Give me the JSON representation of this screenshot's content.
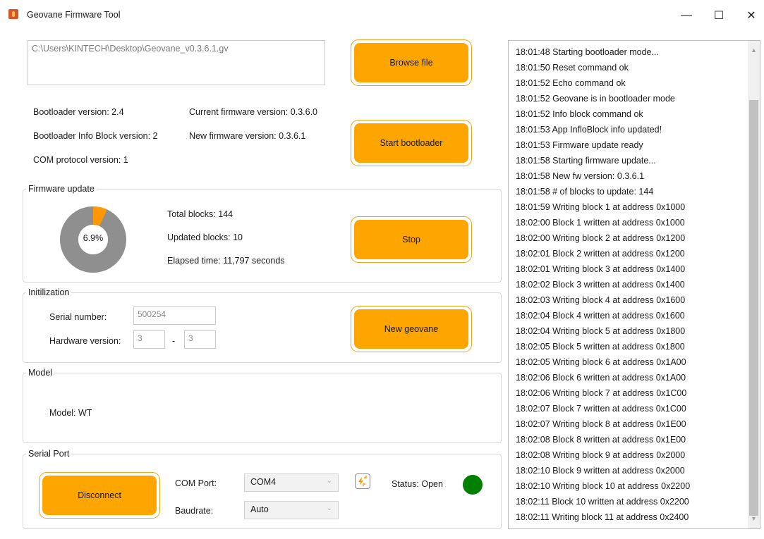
{
  "window": {
    "title": "Geovane Firmware Tool",
    "minimize": "—",
    "maximize": "☐",
    "close": "✕"
  },
  "file": {
    "path": "C:\\Users\\KINTECH\\Desktop\\Geovane_v0.3.6.1.gv",
    "browse_label": "Browse file"
  },
  "versions": {
    "bootloader": "Bootloader version: 2.4",
    "bootloader_info_block": "Bootloader Info Block version: 2",
    "com_protocol": "COM protocol version: 1",
    "current_firmware": "Current firmware version: 0.3.6.0",
    "new_firmware": "New firmware version: 0.3.6.1"
  },
  "start_bootloader_label": "Start bootloader",
  "firmware_update": {
    "group_title": "Firmware update",
    "progress_fraction": 0.069,
    "progress_text": "6.9%",
    "total_blocks": "Total blocks: 144",
    "updated_blocks": "Updated blocks: 10",
    "elapsed_time": "Elapsed time: 11,797 seconds",
    "stop_label": "Stop",
    "colors": {
      "done": "#ff9800",
      "remaining": "#8f8f8f"
    }
  },
  "initialization": {
    "group_title": "Initilization",
    "serial_label": "Serial number:",
    "serial_value": "500254",
    "hardware_label": "Hardware version:",
    "hw_major": "3",
    "hw_separator": "-",
    "hw_minor": "3",
    "new_geovane_label": "New geovane"
  },
  "model": {
    "group_title": "Model",
    "text": "Model: WT"
  },
  "serial_port": {
    "group_title": "Serial Port",
    "disconnect_label": "Disconnect",
    "com_label": "COM Port:",
    "com_value": "COM4",
    "baud_label": "Baudrate:",
    "baud_value": "Auto",
    "refresh_icon": "refresh-icon",
    "status_text": "Status: Open",
    "status_color": "#008000"
  },
  "log": [
    "18:01:48 Starting bootloader mode...",
    "18:01:50 Reset command ok",
    "18:01:52 Echo command ok",
    "18:01:52 Geovane is in bootloader mode",
    "18:01:52 Info block command ok",
    "18:01:53 App InfloBlock info updated!",
    "18:01:53 Firmware update ready",
    "18:01:58 Starting firmware update...",
    "18:01:58 New fw version: 0.3.6.1",
    "18:01:58 # of blocks to update: 144",
    "18:01:59 Writing block 1 at address 0x1000",
    "18:02:00 Block 1 written at address 0x1000",
    "18:02:00 Writing block 2 at address 0x1200",
    "18:02:01 Block 2 written at address 0x1200",
    "18:02:01 Writing block 3 at address 0x1400",
    "18:02:02 Block 3 written at address 0x1400",
    "18:02:03 Writing block 4 at address 0x1600",
    "18:02:04 Block 4 written at address 0x1600",
    "18:02:04 Writing block 5 at address 0x1800",
    "18:02:05 Block 5 written at address 0x1800",
    "18:02:05 Writing block 6 at address 0x1A00",
    "18:02:06 Block 6 written at address 0x1A00",
    "18:02:06 Writing block 7 at address 0x1C00",
    "18:02:07 Block 7 written at address 0x1C00",
    "18:02:07 Writing block 8 at address 0x1E00",
    "18:02:08 Block 8 written at address 0x1E00",
    "18:02:08 Writing block 9 at address 0x2000",
    "18:02:10 Block 9 written at address 0x2000",
    "18:02:10 Writing block 10 at address 0x2200",
    "18:02:11 Block 10 written at address 0x2200",
    "18:02:11 Writing block 11 at address 0x2400"
  ]
}
